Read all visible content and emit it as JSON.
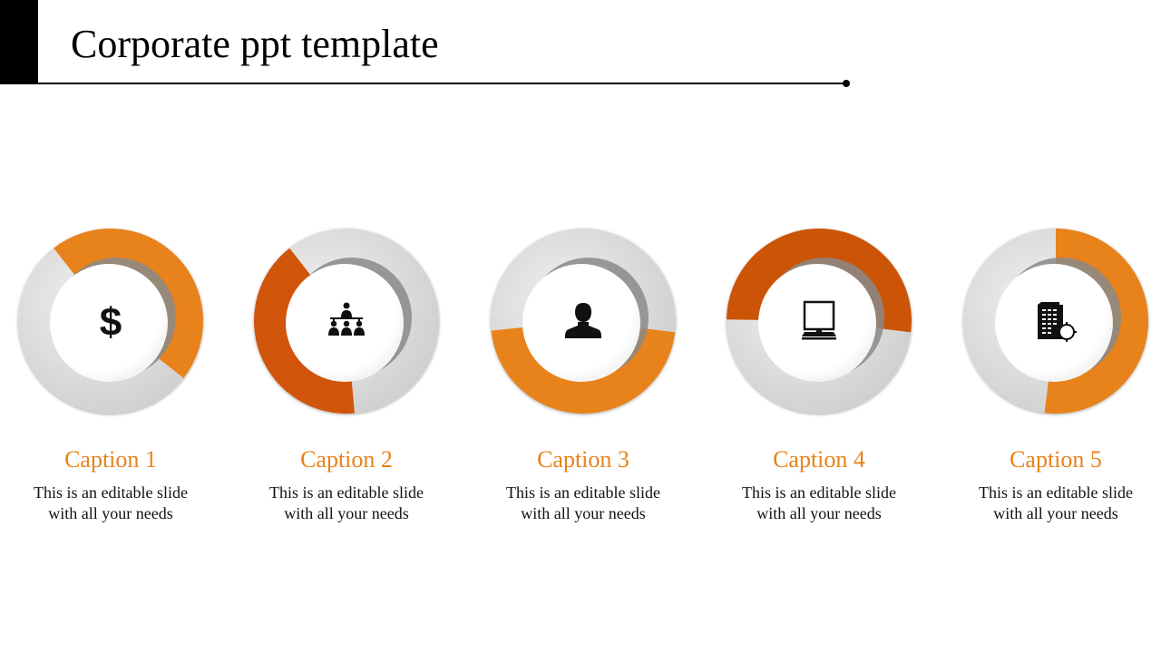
{
  "slide": {
    "title": "Corporate ppt template",
    "colors": {
      "accent_orange": "#e8821a",
      "accent_dark_orange": "#d0540a",
      "ring_gray": "#dcdcdc",
      "caption": "#e8821a"
    }
  },
  "items": [
    {
      "caption": "Caption 1",
      "line1": "This is an editable slide",
      "line2": "with all your needs",
      "icon": "dollar-icon",
      "arc_color": "#e8821a",
      "arc_start_deg": -38,
      "arc_end_deg": 128
    },
    {
      "caption": "Caption 2",
      "line1": "This is an editable slide",
      "line2": "with all your needs",
      "icon": "hierarchy-people-icon",
      "arc_color": "#d0540a",
      "arc_start_deg": 175,
      "arc_end_deg": 322
    },
    {
      "caption": "Caption 3",
      "line1": "This is an editable slide",
      "line2": "with all your needs",
      "icon": "user-icon",
      "arc_color": "#e8821a",
      "arc_start_deg": 97,
      "arc_end_deg": 264
    },
    {
      "caption": "Caption 4",
      "line1": "This is an editable slide",
      "line2": "with all your needs",
      "icon": "computer-icon",
      "arc_color": "#cc5406",
      "arc_start_deg": 271,
      "arc_end_deg": 457
    },
    {
      "caption": "Caption 5",
      "line1": "This is an editable slide",
      "line2": "with all your needs",
      "icon": "building-gear-icon",
      "arc_color": "#e8821a",
      "arc_start_deg": 0,
      "arc_end_deg": 187
    }
  ]
}
